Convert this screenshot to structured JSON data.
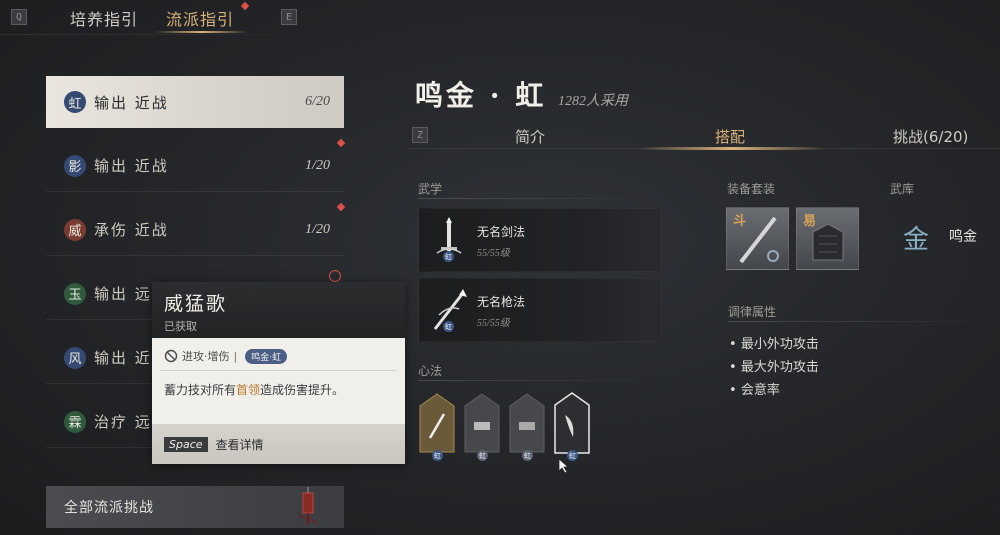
{
  "top_tabs": {
    "left_key": "Q",
    "right_key": "E",
    "items": [
      {
        "label": "培养指引",
        "active": false
      },
      {
        "label": "流派指引",
        "active": true
      }
    ]
  },
  "schools": [
    {
      "badge": "虹",
      "badge_color": "#354a72",
      "label": "输出 近战",
      "count": "6/20",
      "active": true
    },
    {
      "badge": "影",
      "badge_color": "#354a72",
      "label": "输出 近战",
      "count": "1/20",
      "active": false
    },
    {
      "badge": "威",
      "badge_color": "#7a3b30",
      "label": "承伤 近战",
      "count": "1/20",
      "active": false
    },
    {
      "badge": "玉",
      "badge_color": "#2f5a3e",
      "label": "输出 远…",
      "count": "",
      "active": false
    },
    {
      "badge": "风",
      "badge_color": "#354a72",
      "label": "输出 近…",
      "count": "",
      "active": false
    },
    {
      "badge": "霖",
      "badge_color": "#2f5a3e",
      "label": "治疗 远…",
      "count": "",
      "active": false
    }
  ],
  "all_challenge": {
    "label": "全部流派挑战"
  },
  "tooltip": {
    "title": "威猛歌",
    "status": "已获取",
    "tag": "进攻·增伤",
    "pill": "鸣金·虹",
    "desc_prefix": "蓄力技对所有",
    "desc_highlight": "首领",
    "desc_suffix": "造成伤害提升。",
    "key": "Space",
    "action": "查看详情"
  },
  "hero": {
    "title": "鸣金 · 虹",
    "users": "1282人采用"
  },
  "sub_tabs": {
    "key": "Z",
    "items": [
      {
        "label": "简介",
        "active": false
      },
      {
        "label": "搭配",
        "active": true
      },
      {
        "label": "挑战(6/20)",
        "active": false
      }
    ]
  },
  "sections": {
    "martial": "武学",
    "heart": "心法",
    "equip": "装备套装",
    "armory": "武库",
    "attributes": "调律属性"
  },
  "skills": [
    {
      "name": "无名剑法",
      "level": "55/55级",
      "badge": "虹"
    },
    {
      "name": "无名枪法",
      "level": "55/55级",
      "badge": "虹"
    }
  ],
  "heart_slots": [
    {
      "badge": "虹",
      "style": "gold"
    },
    {
      "badge": "虹",
      "style": "grey"
    },
    {
      "badge": "虹",
      "style": "grey"
    },
    {
      "badge": "虹",
      "style": "selected"
    }
  ],
  "equipment": [
    {
      "glyph": "斗"
    },
    {
      "glyph": "易"
    }
  ],
  "armory": {
    "icon": "金",
    "name": "鸣金"
  },
  "attributes": [
    "最小外功攻击",
    "最大外功攻击",
    "会意率"
  ],
  "colors": {
    "accent": "#d9b27a",
    "notify": "#d9514a",
    "badge_blue": "#3c5785"
  }
}
